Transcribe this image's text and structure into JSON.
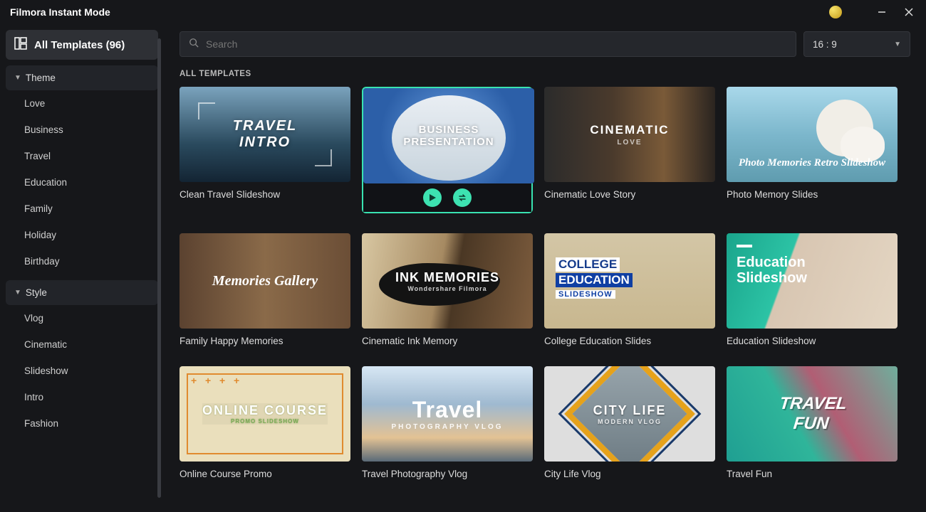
{
  "window": {
    "title": "Filmora Instant Mode"
  },
  "sidebar": {
    "all_label": "All Templates (96)",
    "sections": {
      "theme": {
        "label": "Theme",
        "items": [
          "Love",
          "Business",
          "Travel",
          "Education",
          "Family",
          "Holiday",
          "Birthday"
        ]
      },
      "style": {
        "label": "Style",
        "items": [
          "Vlog",
          "Cinematic",
          "Slideshow",
          "Intro",
          "Fashion"
        ]
      }
    }
  },
  "search": {
    "placeholder": "Search"
  },
  "ratio": {
    "value": "16 : 9"
  },
  "grid": {
    "heading": "ALL TEMPLATES",
    "cards": [
      {
        "name": "Clean Travel Slideshow",
        "art_line1": "TRAVEL",
        "art_line2": "INTRO"
      },
      {
        "name": "Business Presentation",
        "art_line1": "BUSINESS",
        "art_line2": "PRESENTATION",
        "selected": true
      },
      {
        "name": "Cinematic Love Story",
        "art_line1": "CINEMATIC",
        "art_line2": "LOVE"
      },
      {
        "name": "Photo Memory Slides",
        "art_line1": "Photo Memories Retro Slideshow"
      },
      {
        "name": "Family Happy Memories",
        "art_line1": "Memories Gallery"
      },
      {
        "name": "Cinematic Ink Memory",
        "art_line1": "INK MEMORIES",
        "art_line2": "Wondershare Filmora"
      },
      {
        "name": "College Education Slides",
        "art_line1": "COLLEGE",
        "art_line2": "EDUCATION",
        "art_line3": "SLIDESHOW"
      },
      {
        "name": "Education Slideshow",
        "art_line1": "Education",
        "art_line2": "Slideshow"
      },
      {
        "name": "Online Course Promo",
        "art_line1": "ONLINE COURSE",
        "art_line2": "PROMO SLIDESHOW"
      },
      {
        "name": "Travel Photography Vlog",
        "art_line1": "Travel",
        "art_line2": "PHOTOGRAPHY VLOG"
      },
      {
        "name": "City Life Vlog",
        "art_line1": "CITY LIFE",
        "art_line2": "MODERN VLOG"
      },
      {
        "name": "Travel Fun",
        "art_line1": "TRAVEL",
        "art_line2": "FUN"
      }
    ]
  }
}
